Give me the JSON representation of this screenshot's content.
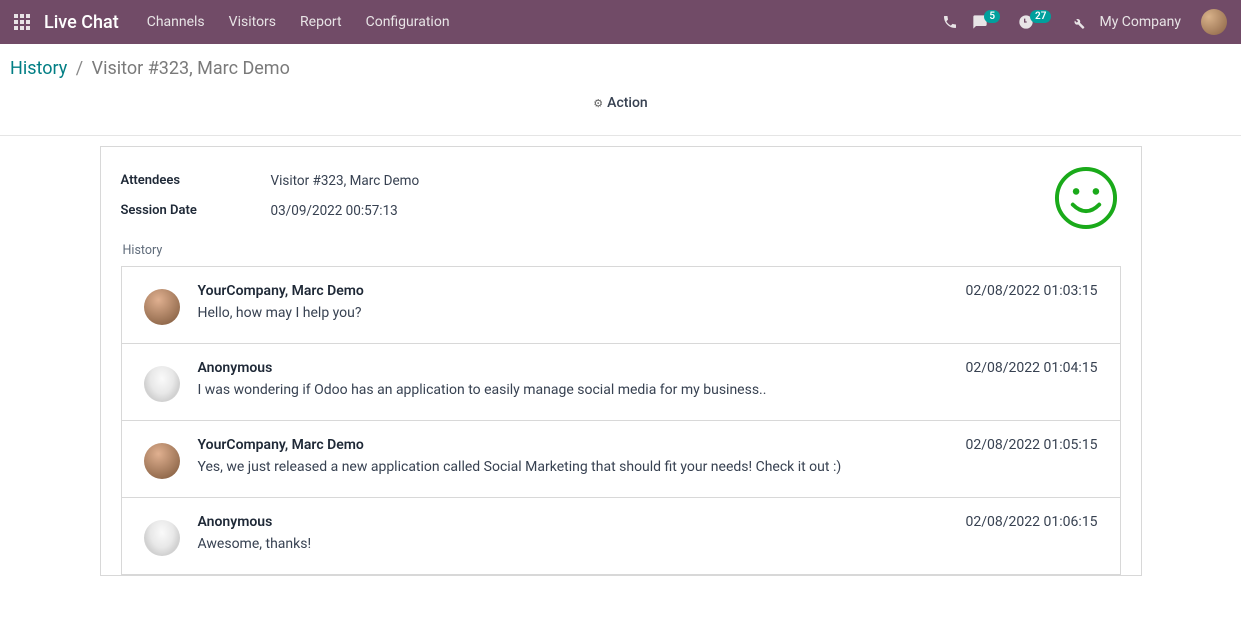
{
  "nav": {
    "brand": "Live Chat",
    "links": [
      "Channels",
      "Visitors",
      "Report",
      "Configuration"
    ],
    "badge_chat": "5",
    "badge_clock": "27",
    "company": "My Company"
  },
  "breadcrumb": {
    "root": "History",
    "current": "Visitor #323, Marc Demo"
  },
  "action_label": "Action",
  "fields": {
    "attendees_label": "Attendees",
    "attendees_value": "Visitor #323, Marc Demo",
    "session_label": "Session Date",
    "session_value": "03/09/2022 00:57:13"
  },
  "history_label": "History",
  "messages": [
    {
      "author": "YourCompany, Marc Demo",
      "date": "02/08/2022 01:03:15",
      "text": "Hello, how may I help you?",
      "avatar": "marc"
    },
    {
      "author": "Anonymous",
      "date": "02/08/2022 01:04:15",
      "text": "I was wondering if Odoo has an application to easily manage social media for my business..",
      "avatar": "anon"
    },
    {
      "author": "YourCompany, Marc Demo",
      "date": "02/08/2022 01:05:15",
      "text": "Yes, we just released a new application called Social Marketing that should fit your needs! Check it out :)",
      "avatar": "marc"
    },
    {
      "author": "Anonymous",
      "date": "02/08/2022 01:06:15",
      "text": "Awesome, thanks!",
      "avatar": "anon"
    }
  ]
}
